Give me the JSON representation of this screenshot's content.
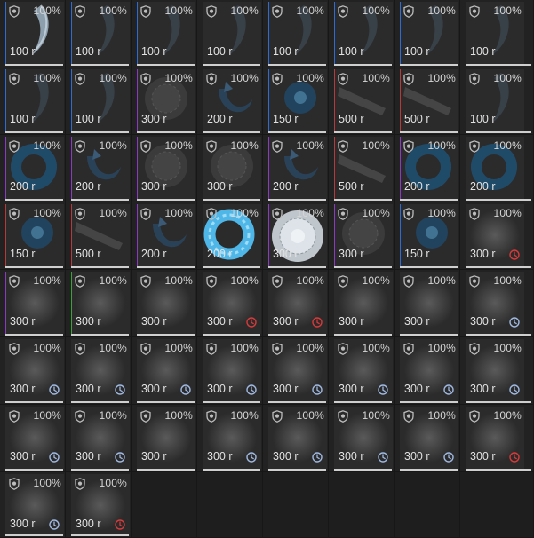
{
  "inventory": {
    "items": [
      {
        "percent": "100%",
        "price": "100 r",
        "art": "claw-pale",
        "rarity": "#2f6bd0",
        "bar": true
      },
      {
        "percent": "100%",
        "price": "100 r",
        "art": "claw-dark",
        "rarity": "#2f6bd0",
        "bar": true
      },
      {
        "percent": "100%",
        "price": "100 r",
        "art": "claw-dark",
        "rarity": "#2f6bd0",
        "bar": true
      },
      {
        "percent": "100%",
        "price": "100 r",
        "art": "claw-dark",
        "rarity": "#2f6bd0",
        "bar": true
      },
      {
        "percent": "100%",
        "price": "100 r",
        "art": "claw-dark",
        "rarity": "#2f6bd0",
        "bar": true
      },
      {
        "percent": "100%",
        "price": "100 r",
        "art": "claw-dark",
        "rarity": "#2f6bd0",
        "bar": true
      },
      {
        "percent": "100%",
        "price": "100 r",
        "art": "claw-dark",
        "rarity": "#2f6bd0",
        "bar": true
      },
      {
        "percent": "100%",
        "price": "100 r",
        "art": "claw-dark",
        "rarity": "#2f6bd0",
        "bar": true
      },
      {
        "percent": "100%",
        "price": "100 r",
        "art": "claw-dark",
        "rarity": "#2f6bd0",
        "bar": true
      },
      {
        "percent": "100%",
        "price": "100 r",
        "art": "claw-dark",
        "rarity": "#2f6bd0",
        "bar": true
      },
      {
        "percent": "100%",
        "price": "300 r",
        "art": "flower-grey",
        "rarity": "#8a3bc2",
        "bar": true
      },
      {
        "percent": "100%",
        "price": "200 r",
        "art": "hook-blue",
        "rarity": "#8a3bc2",
        "bar": true
      },
      {
        "percent": "100%",
        "price": "150 r",
        "art": "crystal-blue",
        "rarity": "#2f6bd0",
        "bar": true
      },
      {
        "percent": "100%",
        "price": "500 r",
        "art": "log-grey",
        "rarity": "#b53a3a",
        "bar": true
      },
      {
        "percent": "100%",
        "price": "500 r",
        "art": "log-grey",
        "rarity": "#b53a3a",
        "bar": true
      },
      {
        "percent": "100%",
        "price": "100 r",
        "art": "claw-dark",
        "rarity": "#2f6bd0",
        "bar": true
      },
      {
        "percent": "100%",
        "price": "200 r",
        "art": "ring-blue",
        "rarity": "#8a3bc2",
        "bar": true
      },
      {
        "percent": "100%",
        "price": "200 r",
        "art": "hook-blue",
        "rarity": "#8a3bc2",
        "bar": true
      },
      {
        "percent": "100%",
        "price": "300 r",
        "art": "flower-grey",
        "rarity": "#8a3bc2",
        "bar": true
      },
      {
        "percent": "100%",
        "price": "300 r",
        "art": "flower-grey",
        "rarity": "#8a3bc2",
        "bar": true
      },
      {
        "percent": "100%",
        "price": "200 r",
        "art": "hook-blue",
        "rarity": "#8a3bc2",
        "bar": true
      },
      {
        "percent": "100%",
        "price": "500 r",
        "art": "log-grey",
        "rarity": "#b53a3a",
        "bar": true
      },
      {
        "percent": "100%",
        "price": "200 r",
        "art": "ring-blue",
        "rarity": "#8a3bc2",
        "bar": true
      },
      {
        "percent": "100%",
        "price": "200 r",
        "art": "ring-blue",
        "rarity": "#8a3bc2",
        "bar": true
      },
      {
        "percent": "100%",
        "price": "150 r",
        "art": "crystal-blue",
        "rarity": "#b53a3a",
        "bar": true
      },
      {
        "percent": "100%",
        "price": "500 r",
        "art": "log-grey",
        "rarity": "#b53a3a",
        "bar": true
      },
      {
        "percent": "100%",
        "price": "200 r",
        "art": "hook-blue",
        "rarity": "#8a3bc2",
        "bar": true
      },
      {
        "percent": "100%",
        "price": "200 r",
        "art": "ring-bright",
        "rarity": "#8a3bc2",
        "bar": true
      },
      {
        "percent": "100%",
        "price": "300 r",
        "art": "flower-bright",
        "rarity": "#8a3bc2",
        "bar": true
      },
      {
        "percent": "100%",
        "price": "300 r",
        "art": "flower-grey",
        "rarity": "#8a3bc2",
        "bar": true
      },
      {
        "percent": "100%",
        "price": "150 r",
        "art": "crystal-blue",
        "rarity": "#2f6bd0",
        "bar": true
      },
      {
        "percent": "100%",
        "price": "300 r",
        "art": "blur",
        "rarity": "",
        "bar": true,
        "timer": "red"
      },
      {
        "percent": "100%",
        "price": "300 r",
        "art": "blur",
        "rarity": "#8a3bc2",
        "bar": true
      },
      {
        "percent": "100%",
        "price": "300 r",
        "art": "blur",
        "rarity": "#3aa23a",
        "bar": true
      },
      {
        "percent": "100%",
        "price": "300 r",
        "art": "blur",
        "rarity": "",
        "bar": true
      },
      {
        "percent": "100%",
        "price": "300 r",
        "art": "blur",
        "rarity": "",
        "bar": true,
        "timer": "red"
      },
      {
        "percent": "100%",
        "price": "300 r",
        "art": "blur",
        "rarity": "",
        "bar": true,
        "timer": "red"
      },
      {
        "percent": "100%",
        "price": "300 r",
        "art": "blur",
        "rarity": "",
        "bar": true
      },
      {
        "percent": "100%",
        "price": "300 r",
        "art": "blur",
        "rarity": "",
        "bar": true
      },
      {
        "percent": "100%",
        "price": "300 r",
        "art": "blur",
        "rarity": "",
        "bar": true,
        "timer": "blue"
      },
      {
        "percent": "100%",
        "price": "300 r",
        "art": "blur",
        "rarity": "",
        "bar": true,
        "timer": "blue"
      },
      {
        "percent": "100%",
        "price": "300 r",
        "art": "blur",
        "rarity": "",
        "bar": true,
        "timer": "blue"
      },
      {
        "percent": "100%",
        "price": "300 r",
        "art": "blur",
        "rarity": "",
        "bar": true,
        "timer": "blue"
      },
      {
        "percent": "100%",
        "price": "300 r",
        "art": "blur",
        "rarity": "",
        "bar": true,
        "timer": "blue"
      },
      {
        "percent": "100%",
        "price": "300 r",
        "art": "blur",
        "rarity": "",
        "bar": true,
        "timer": "blue"
      },
      {
        "percent": "100%",
        "price": "300 r",
        "art": "blur",
        "rarity": "",
        "bar": true,
        "timer": "blue"
      },
      {
        "percent": "100%",
        "price": "300 r",
        "art": "blur",
        "rarity": "",
        "bar": true,
        "timer": "blue"
      },
      {
        "percent": "100%",
        "price": "300 r",
        "art": "blur",
        "rarity": "",
        "bar": true,
        "timer": "blue"
      },
      {
        "percent": "100%",
        "price": "300 r",
        "art": "blur",
        "rarity": "",
        "bar": true,
        "timer": "blue"
      },
      {
        "percent": "100%",
        "price": "300 r",
        "art": "blur",
        "rarity": "",
        "bar": true,
        "timer": "blue"
      },
      {
        "percent": "100%",
        "price": "300 r",
        "art": "blur",
        "rarity": "",
        "bar": true
      },
      {
        "percent": "100%",
        "price": "300 r",
        "art": "blur",
        "rarity": "",
        "bar": true,
        "timer": "blue"
      },
      {
        "percent": "100%",
        "price": "300 r",
        "art": "blur",
        "rarity": "",
        "bar": true,
        "timer": "blue"
      },
      {
        "percent": "100%",
        "price": "300 r",
        "art": "blur",
        "rarity": "",
        "bar": true,
        "timer": "blue"
      },
      {
        "percent": "100%",
        "price": "300 r",
        "art": "blur",
        "rarity": "",
        "bar": true,
        "timer": "blue"
      },
      {
        "percent": "100%",
        "price": "300 r",
        "art": "blur",
        "rarity": "",
        "bar": true,
        "timer": "red"
      },
      {
        "percent": "100%",
        "price": "300 r",
        "art": "blur",
        "rarity": "",
        "bar": true,
        "timer": "blue"
      },
      {
        "percent": "100%",
        "price": "300 r",
        "art": "blur",
        "rarity": "",
        "bar": true,
        "timer": "red"
      }
    ],
    "colors": {
      "timer_red": "#d63a3a",
      "timer_blue": "#9fb8e0",
      "percent_text": "#d6d6d6",
      "price_text": "#e2e2e2"
    }
  }
}
